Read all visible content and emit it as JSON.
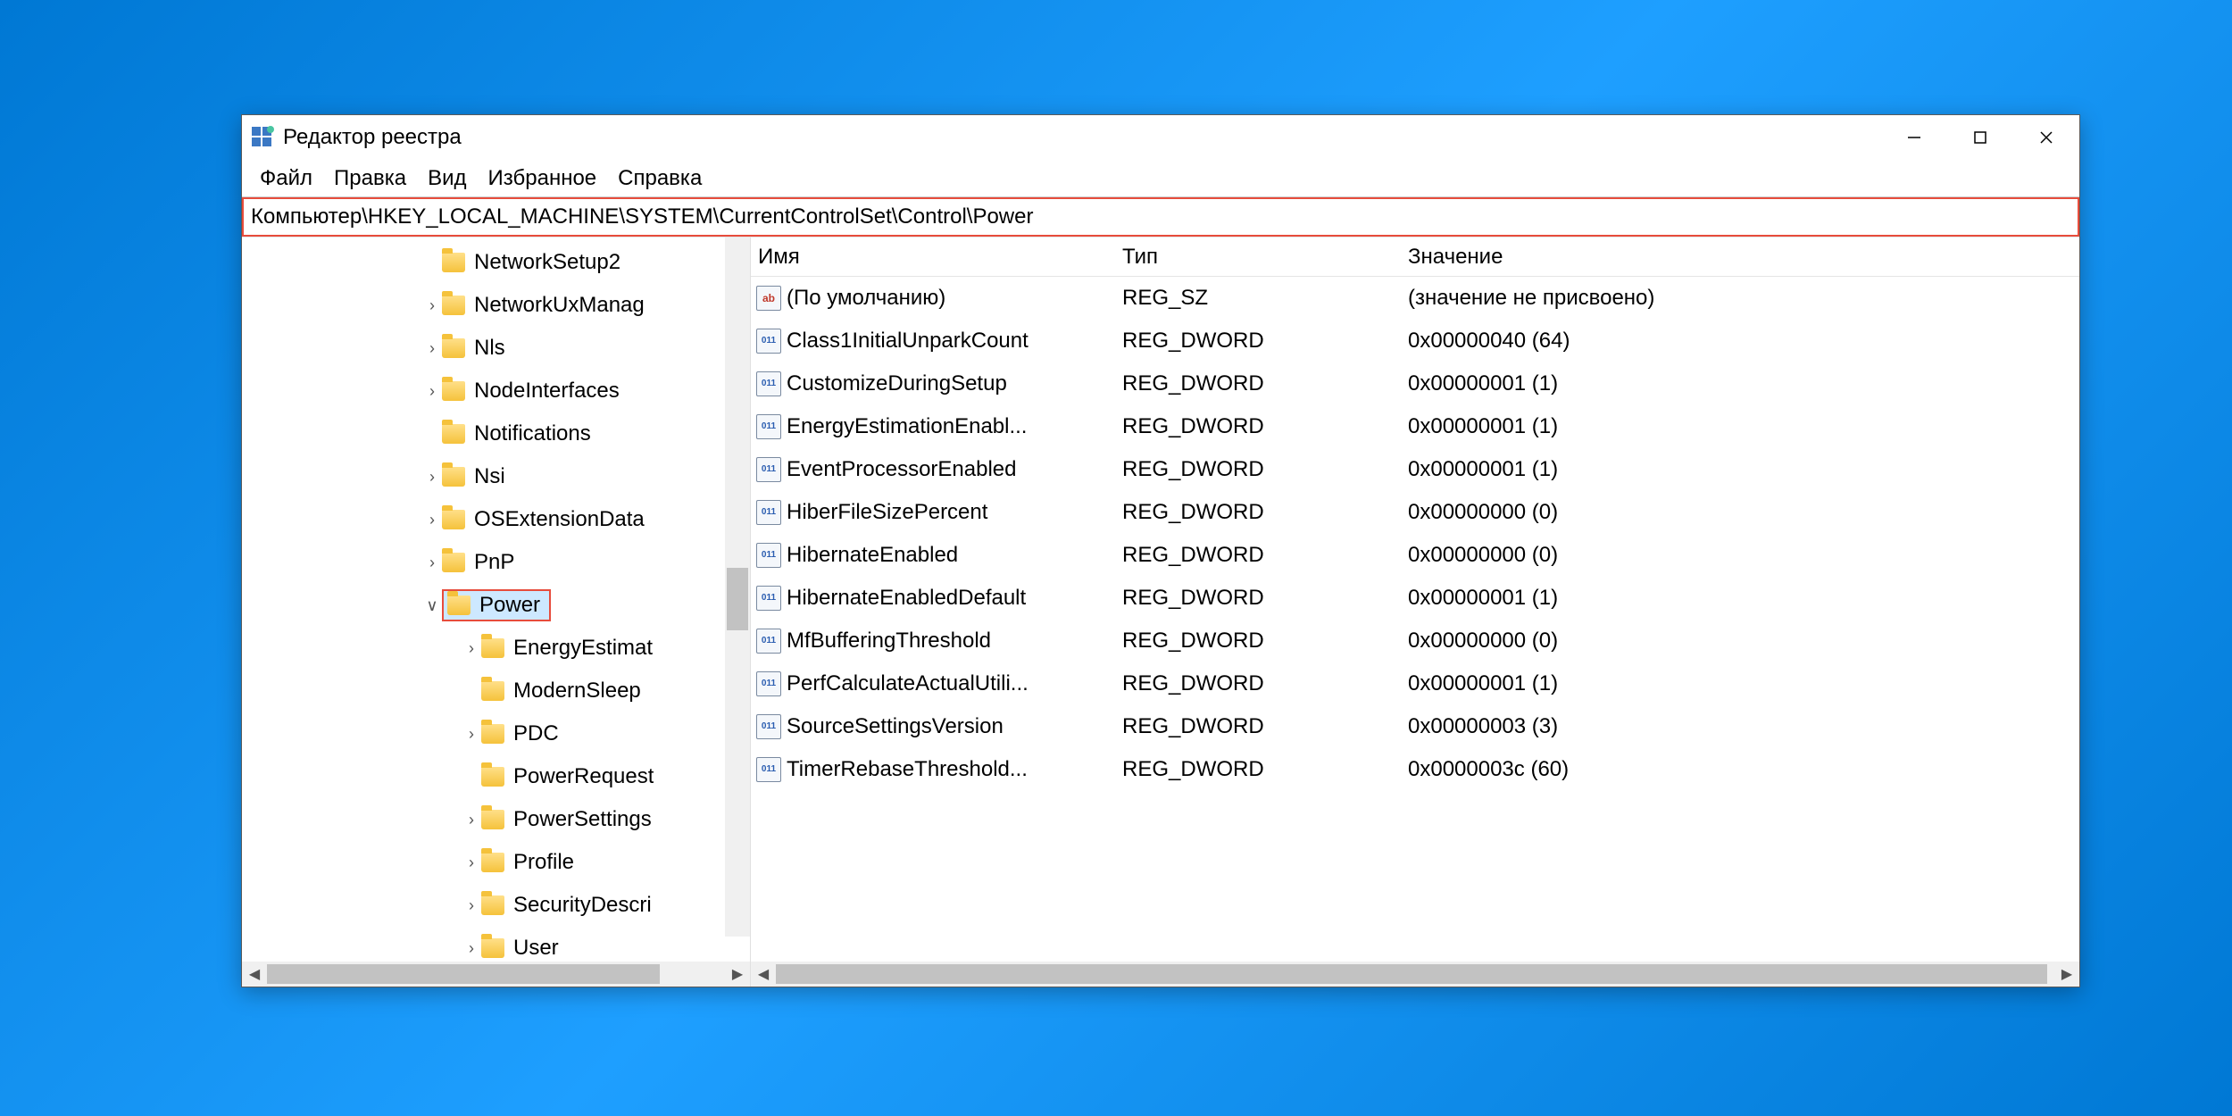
{
  "window": {
    "title": "Редактор реестра"
  },
  "menu": {
    "file": "Файл",
    "edit": "Правка",
    "view": "Вид",
    "favorites": "Избранное",
    "help": "Справка"
  },
  "address": {
    "path": "Компьютер\\HKEY_LOCAL_MACHINE\\SYSTEM\\CurrentControlSet\\Control\\Power"
  },
  "tree": {
    "items": [
      {
        "label": "NetworkSetup2",
        "expander": "",
        "depth": 0,
        "selected": false
      },
      {
        "label": "NetworkUxManag",
        "expander": ">",
        "depth": 0,
        "selected": false
      },
      {
        "label": "Nls",
        "expander": ">",
        "depth": 0,
        "selected": false
      },
      {
        "label": "NodeInterfaces",
        "expander": ">",
        "depth": 0,
        "selected": false
      },
      {
        "label": "Notifications",
        "expander": "",
        "depth": 0,
        "selected": false
      },
      {
        "label": "Nsi",
        "expander": ">",
        "depth": 0,
        "selected": false
      },
      {
        "label": "OSExtensionData",
        "expander": ">",
        "depth": 0,
        "selected": false
      },
      {
        "label": "PnP",
        "expander": ">",
        "depth": 0,
        "selected": false
      },
      {
        "label": "Power",
        "expander": "v",
        "depth": 0,
        "selected": true
      },
      {
        "label": "EnergyEstimat",
        "expander": ">",
        "depth": 1,
        "selected": false
      },
      {
        "label": "ModernSleep",
        "expander": "",
        "depth": 1,
        "selected": false
      },
      {
        "label": "PDC",
        "expander": ">",
        "depth": 1,
        "selected": false
      },
      {
        "label": "PowerRequest",
        "expander": "",
        "depth": 1,
        "selected": false
      },
      {
        "label": "PowerSettings",
        "expander": ">",
        "depth": 1,
        "selected": false
      },
      {
        "label": "Profile",
        "expander": ">",
        "depth": 1,
        "selected": false
      },
      {
        "label": "SecurityDescri",
        "expander": ">",
        "depth": 1,
        "selected": false
      },
      {
        "label": "User",
        "expander": ">",
        "depth": 1,
        "selected": false
      }
    ]
  },
  "list": {
    "headers": {
      "name": "Имя",
      "type": "Тип",
      "value": "Значение"
    },
    "rows": [
      {
        "icon": "sz",
        "name": "(По умолчанию)",
        "type": "REG_SZ",
        "value": "(значение не присвоено)"
      },
      {
        "icon": "dw",
        "name": "Class1InitialUnparkCount",
        "type": "REG_DWORD",
        "value": "0x00000040 (64)"
      },
      {
        "icon": "dw",
        "name": "CustomizeDuringSetup",
        "type": "REG_DWORD",
        "value": "0x00000001 (1)"
      },
      {
        "icon": "dw",
        "name": "EnergyEstimationEnabl...",
        "type": "REG_DWORD",
        "value": "0x00000001 (1)"
      },
      {
        "icon": "dw",
        "name": "EventProcessorEnabled",
        "type": "REG_DWORD",
        "value": "0x00000001 (1)"
      },
      {
        "icon": "dw",
        "name": "HiberFileSizePercent",
        "type": "REG_DWORD",
        "value": "0x00000000 (0)"
      },
      {
        "icon": "dw",
        "name": "HibernateEnabled",
        "type": "REG_DWORD",
        "value": "0x00000000 (0)"
      },
      {
        "icon": "dw",
        "name": "HibernateEnabledDefault",
        "type": "REG_DWORD",
        "value": "0x00000001 (1)"
      },
      {
        "icon": "dw",
        "name": "MfBufferingThreshold",
        "type": "REG_DWORD",
        "value": "0x00000000 (0)"
      },
      {
        "icon": "dw",
        "name": "PerfCalculateActualUtili...",
        "type": "REG_DWORD",
        "value": "0x00000001 (1)"
      },
      {
        "icon": "dw",
        "name": "SourceSettingsVersion",
        "type": "REG_DWORD",
        "value": "0x00000003 (3)"
      },
      {
        "icon": "dw",
        "name": "TimerRebaseThreshold...",
        "type": "REG_DWORD",
        "value": "0x0000003c (60)"
      }
    ]
  },
  "icons": {
    "sz_label": "ab",
    "dw_label": "011\n110"
  }
}
